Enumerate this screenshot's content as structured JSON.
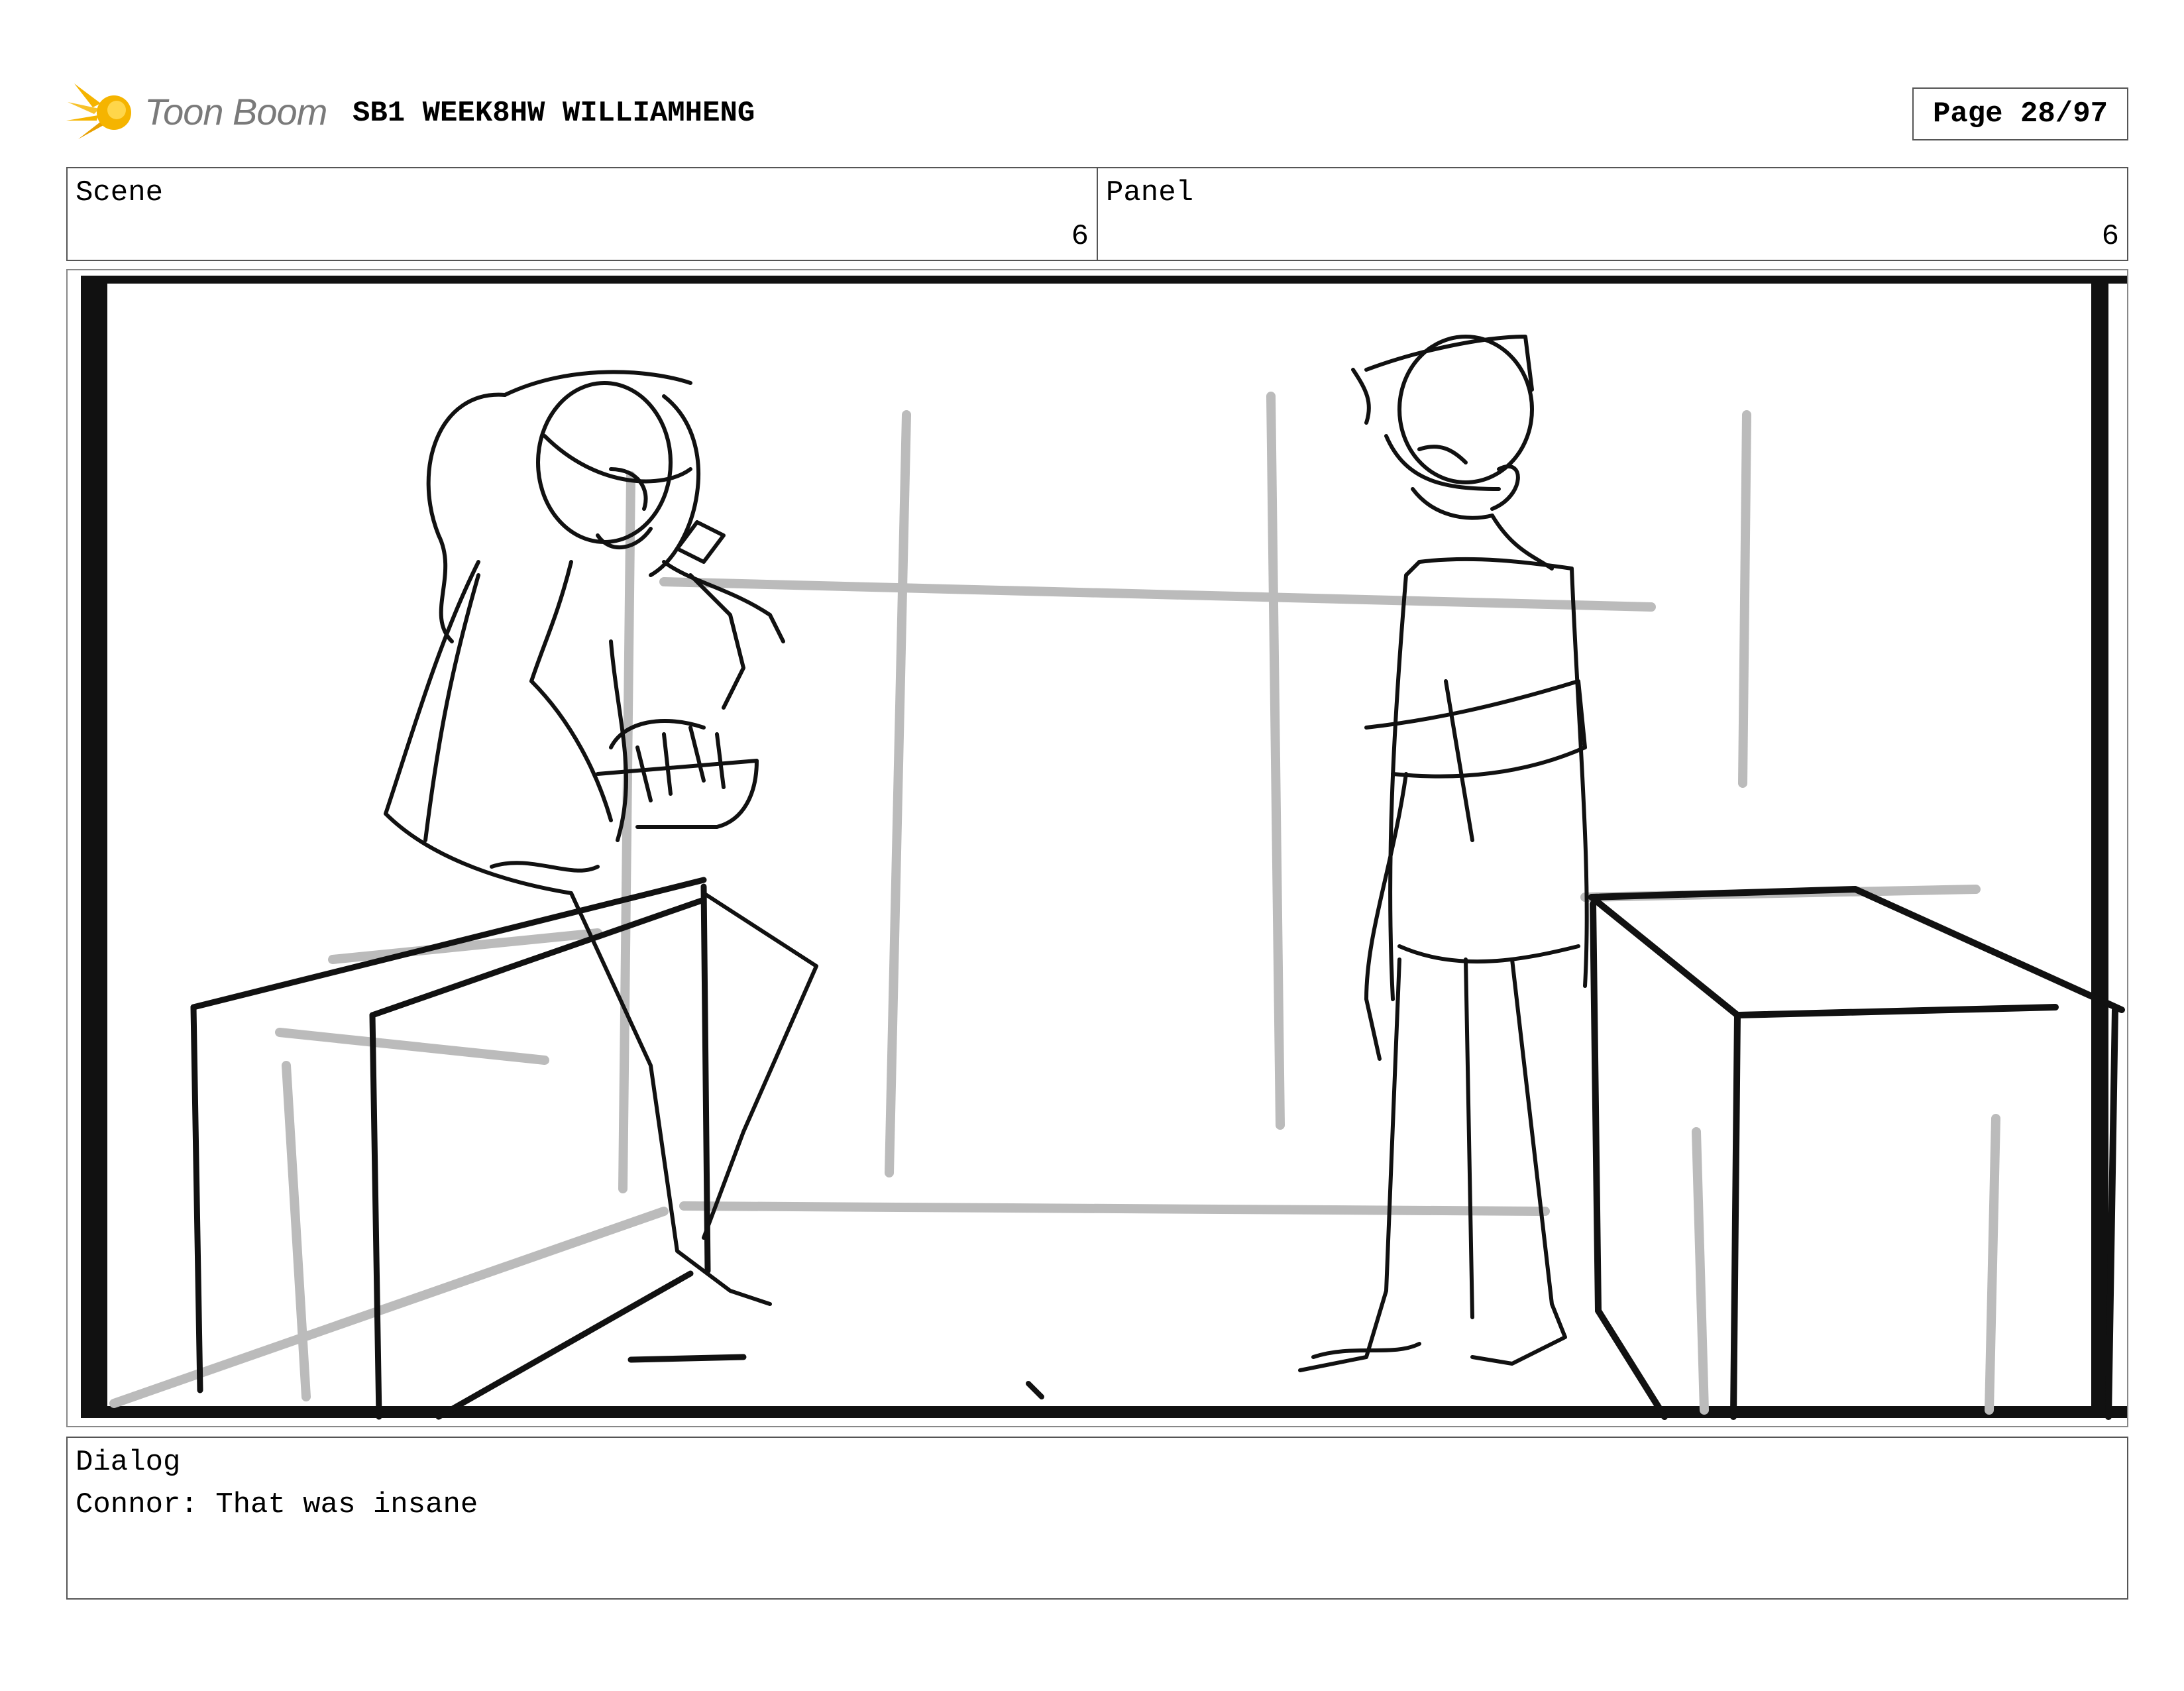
{
  "header": {
    "logo_text": "Toon Boom",
    "project_title": "SB1 WEEK8HW WILLIAMHENG",
    "page_label": "Page 28/97"
  },
  "info": {
    "scene_label": "Scene",
    "scene_value": "6",
    "panel_label": "Panel",
    "panel_value": "6"
  },
  "dialog": {
    "label": "Dialog",
    "text": "Connor: That was insane"
  },
  "colors": {
    "logo_accent": "#f5b400",
    "logo_text": "#7a7a7a",
    "sketch_ink": "#111111",
    "guide_gray": "#bbbbbb"
  }
}
